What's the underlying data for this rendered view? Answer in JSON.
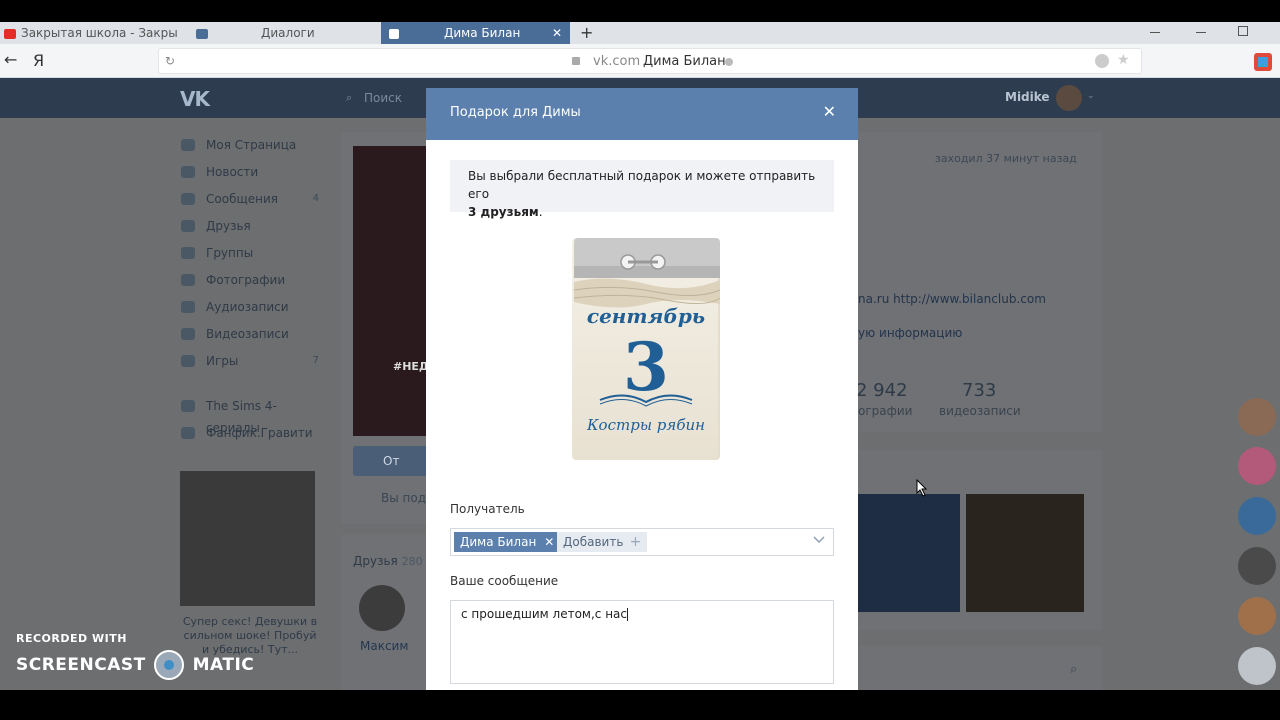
{
  "browser": {
    "tabs": [
      {
        "label": "Закрытая школа - Закрыта"
      },
      {
        "label": "Диалоги"
      },
      {
        "label": "Дима Билан",
        "close": "✕"
      }
    ],
    "new_tab": "+",
    "back": "←",
    "yandex_logo": "Я",
    "url_domain": "vk.com",
    "url_title": "Дима Билан"
  },
  "vk": {
    "logo": "VK",
    "search_placeholder": "Поиск",
    "user_name": "Midike",
    "nav": [
      {
        "label": "Моя Страница",
        "count": ""
      },
      {
        "label": "Новости",
        "count": ""
      },
      {
        "label": "Сообщения",
        "count": "4"
      },
      {
        "label": "Друзья",
        "count": ""
      },
      {
        "label": "Группы",
        "count": ""
      },
      {
        "label": "Фотографии",
        "count": ""
      },
      {
        "label": "Аудиозаписи",
        "count": ""
      },
      {
        "label": "Видеозаписи",
        "count": ""
      },
      {
        "label": "Игры",
        "count": "7"
      }
    ],
    "nav_groups": [
      {
        "label": "The Sims 4-сериалы"
      },
      {
        "label": "Фанфик.Гравити"
      }
    ],
    "ad_text": "Супер секс! Девушки в сильном шоке! Пробуй и убедись! Тут...",
    "cover_tag": "#НЕД",
    "gift_button_partial": "От",
    "you_partial": "Вы под",
    "friends_label": "Друзья",
    "friends_count": "280",
    "friend_name": "Максим",
    "last_seen": "заходил 37 минут назад",
    "site_partial": "na.ru http://www.bilanclub.com",
    "info_partial": "ую информацию",
    "photos_count": "2 942",
    "photos_label": "ографии",
    "videos_count": "733",
    "videos_label": "видеозаписи"
  },
  "modal": {
    "title": "Подарок для Димы",
    "close": "✕",
    "notice_text": "Вы выбрали бесплатный подарок и можете отправить его",
    "notice_bold": "3 друзьям",
    "notice_end": ".",
    "gift": {
      "month": "сентябрь",
      "day": "3",
      "caption": "Костры рябин"
    },
    "recipient_label": "Получатель",
    "recipient_chip": "Дима Билан",
    "chip_remove": "✕",
    "add_label": "Добавить",
    "add_plus": "+",
    "message_label": "Ваше сообщение",
    "message_value": "с прошедшим летом,с нас"
  },
  "watermark": {
    "line1": "RECORDED WITH",
    "line2_a": "SCREENCAST",
    "line2_b": "MATIC"
  }
}
